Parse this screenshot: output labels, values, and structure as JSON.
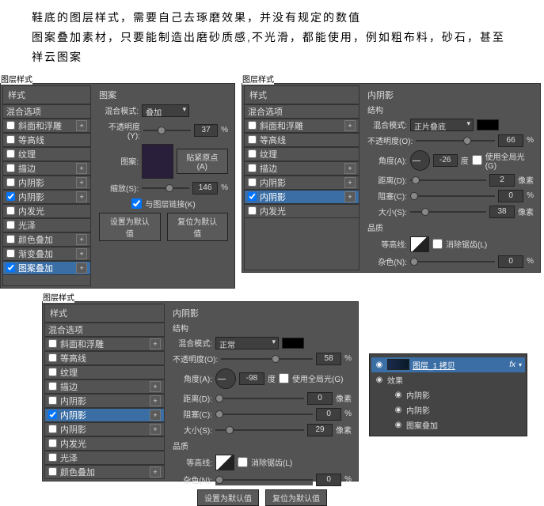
{
  "intro": {
    "p1": "鞋底的图层样式，需要自己去琢磨效果，并没有规定的数值",
    "p2": "图案叠加素材，只要能制造出磨砂质感,不光滑，都能使用，例如粗布料，砂石，甚至祥云图案"
  },
  "panel_label": "图层样式",
  "styles_header": "样式",
  "blend_options": "混合选项",
  "style_items": {
    "bevel": "斜面和浮雕",
    "contour": "等高线",
    "texture": "纹理",
    "stroke": "描边",
    "inner_shadow": "内阴影",
    "inner_glow": "内发光",
    "satin": "光泽",
    "color_overlay": "颜色叠加",
    "gradient_overlay": "渐变叠加",
    "pattern_overlay": "图案叠加"
  },
  "pattern_panel": {
    "title": "图案",
    "blend_mode_lbl": "混合模式:",
    "blend_mode_val": "叠加",
    "opacity_lbl": "不透明度(Y):",
    "opacity_val": "37",
    "pattern_lbl": "图案:",
    "snap_btn": "贴紧原点(A)",
    "scale_lbl": "缩放(S):",
    "scale_val": "146",
    "link_chk": "与图层链接(K)",
    "default_btn": "设置为默认值",
    "reset_btn": "复位为默认值"
  },
  "inner_shadow_panel": {
    "title": "内阴影",
    "structure": "结构",
    "blend_mode_lbl": "混合模式:",
    "blend_mode_val_1": "正片叠底",
    "blend_mode_val_2": "正常",
    "opacity_lbl": "不透明度(O):",
    "opacity_val_1": "66",
    "opacity_val_2": "58",
    "angle_lbl": "角度(A):",
    "angle_val_1": "-26",
    "angle_val_2": "-98",
    "degree": "度",
    "global_light": "使用全局光(G)",
    "distance_lbl": "距离(D):",
    "distance_val_1": "2",
    "distance_val_2": "0",
    "px": "像素",
    "choke_lbl": "阻塞(C):",
    "choke_val_1": "0",
    "choke_val_2": "0",
    "size_lbl": "大小(S):",
    "size_val_1": "38",
    "size_val_2": "29",
    "quality": "品质",
    "contour_lbl": "等高线:",
    "anti_alias": "消除锯齿(L)",
    "noise_lbl": "杂色(N):",
    "noise_val": "0"
  },
  "layers_panel": {
    "layer_name": "图层_1 拷贝",
    "fx": "fx",
    "effects": "效果",
    "inner_shadow": "内阴影",
    "pattern_overlay": "图案叠加"
  }
}
